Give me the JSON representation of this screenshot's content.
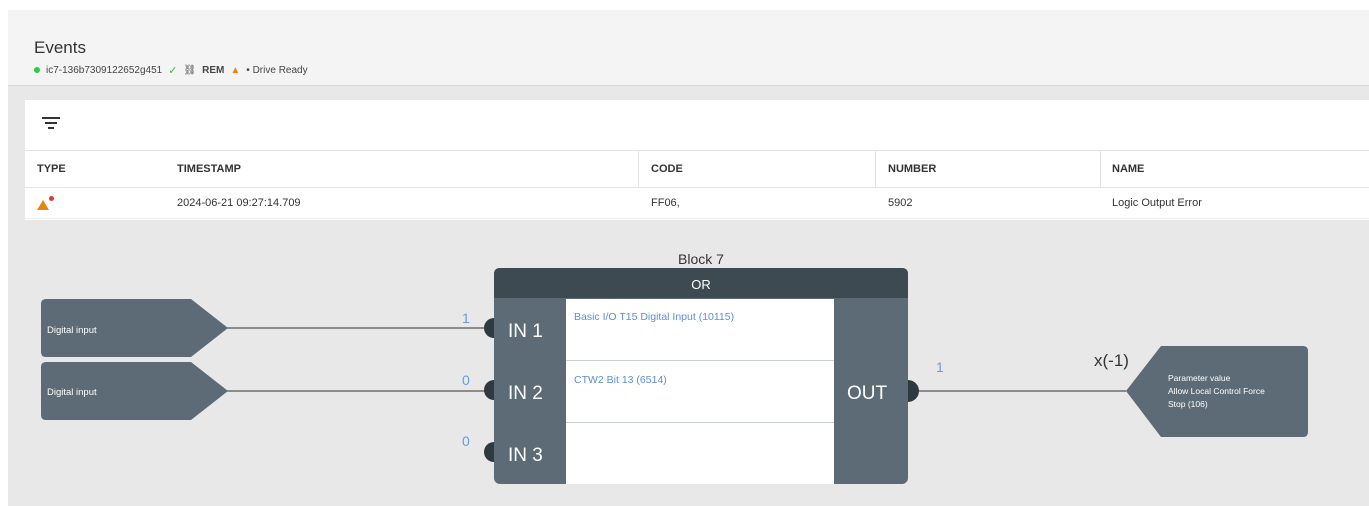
{
  "header": {
    "title": "Events",
    "device_id": "ic7-136b7309122652g451",
    "mode": "REM",
    "status": "• Drive Ready"
  },
  "table": {
    "columns": [
      "TYPE",
      "TIMESTAMP",
      "CODE",
      "NUMBER",
      "NAME"
    ],
    "rows": [
      {
        "timestamp": "2024-06-21 09:27:14.709",
        "code": "FF06,",
        "number": "5902",
        "name": "Logic Output Error"
      }
    ]
  },
  "diagram": {
    "block_title": "Block 7",
    "block_type": "OR",
    "inputs": [
      {
        "source": "Digital input",
        "value": "1",
        "port": "IN 1",
        "signal": "Basic I/O T15 Digital Input (10115)"
      },
      {
        "source": "Digital input",
        "value": "0",
        "port": "IN 2",
        "signal": "CTW2 Bit 13 (6514)"
      },
      {
        "value": "0",
        "port": "IN 3",
        "signal": ""
      }
    ],
    "output": {
      "port": "OUT",
      "value": "1",
      "modifier": "x(-1)",
      "target_title": "Parameter value",
      "target_line1": "Allow Local Control Force",
      "target_line2": "Stop (106)"
    }
  },
  "colors": {
    "block_dark": "#3d4a52",
    "block_body": "#5c6b75",
    "link_blue": "#5b8fd6",
    "value_blue": "#6a9be0",
    "warning": "#e8870e"
  }
}
